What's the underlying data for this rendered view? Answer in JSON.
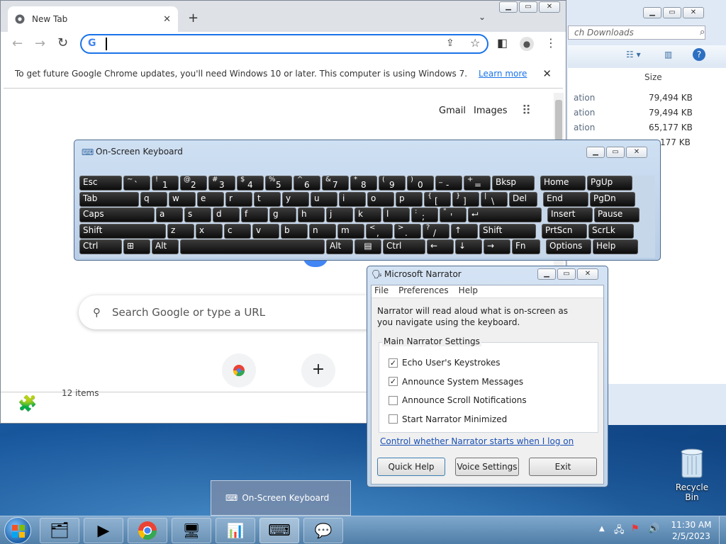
{
  "chrome": {
    "tab_title": "New Tab",
    "omnibox_value": "",
    "infobar_text": "To get future Google Chrome updates, you'll need Windows 10 or later. This computer is using Windows 7.",
    "infobar_link": "Learn more",
    "ntp_links": [
      "Gmail",
      "Images"
    ],
    "ntp_search_placeholder": "Search Google or type a URL",
    "status_fragment": "12 items"
  },
  "explorer": {
    "search_placeholder": "ch Downloads",
    "size_header": "Size",
    "rows": [
      {
        "type": "ation",
        "size": "79,494 KB"
      },
      {
        "type": "ation",
        "size": "79,494 KB"
      },
      {
        "type": "ation",
        "size": "65,177 KB"
      },
      {
        "type": "",
        "size": "177 KB"
      }
    ]
  },
  "osk": {
    "title": "On-Screen Keyboard",
    "rows": [
      [
        [
          "Esc",
          ""
        ],
        [
          "`",
          "~"
        ],
        [
          "1",
          "!"
        ],
        [
          "2",
          "@"
        ],
        [
          "3",
          "#"
        ],
        [
          "4",
          "$"
        ],
        [
          "5",
          "%"
        ],
        [
          "6",
          "^"
        ],
        [
          "7",
          "&"
        ],
        [
          "8",
          "*"
        ],
        [
          "9",
          "("
        ],
        [
          "0",
          ")"
        ],
        [
          "-",
          "_"
        ],
        [
          "=",
          "+"
        ],
        [
          "Bksp",
          ""
        ],
        [
          "Home",
          ""
        ],
        [
          "PgUp",
          ""
        ]
      ],
      [
        [
          "Tab",
          ""
        ],
        [
          "q",
          ""
        ],
        [
          "w",
          ""
        ],
        [
          "e",
          ""
        ],
        [
          "r",
          ""
        ],
        [
          "t",
          ""
        ],
        [
          "y",
          ""
        ],
        [
          "u",
          ""
        ],
        [
          "i",
          ""
        ],
        [
          "o",
          ""
        ],
        [
          "p",
          ""
        ],
        [
          "[",
          "{"
        ],
        [
          "]",
          "}"
        ],
        [
          "\\",
          "|"
        ],
        [
          "Del",
          ""
        ],
        [
          "End",
          ""
        ],
        [
          "PgDn",
          ""
        ]
      ],
      [
        [
          "Caps",
          ""
        ],
        [
          "a",
          ""
        ],
        [
          "s",
          ""
        ],
        [
          "d",
          ""
        ],
        [
          "f",
          ""
        ],
        [
          "g",
          ""
        ],
        [
          "h",
          ""
        ],
        [
          "j",
          ""
        ],
        [
          "k",
          ""
        ],
        [
          "l",
          ""
        ],
        [
          ";",
          ":"
        ],
        [
          "'",
          "\""
        ],
        [
          "⮠",
          ""
        ],
        [
          "Insert",
          ""
        ],
        [
          "Pause",
          ""
        ]
      ],
      [
        [
          "Shift",
          ""
        ],
        [
          "z",
          ""
        ],
        [
          "x",
          ""
        ],
        [
          "c",
          ""
        ],
        [
          "v",
          ""
        ],
        [
          "b",
          ""
        ],
        [
          "n",
          ""
        ],
        [
          "m",
          ""
        ],
        [
          ",",
          "<"
        ],
        [
          ".",
          ">"
        ],
        [
          "/",
          "?"
        ],
        [
          "↑",
          ""
        ],
        [
          "Shift",
          ""
        ],
        [
          "PrtScn",
          ""
        ],
        [
          "ScrLk",
          ""
        ]
      ],
      [
        [
          "Ctrl",
          ""
        ],
        [
          "⊞",
          ""
        ],
        [
          "Alt",
          ""
        ],
        [
          "",
          ""
        ],
        [
          "Alt",
          ""
        ],
        [
          "▤",
          ""
        ],
        [
          "Ctrl",
          ""
        ],
        [
          "←",
          ""
        ],
        [
          "↓",
          ""
        ],
        [
          "→",
          ""
        ],
        [
          "Fn",
          ""
        ],
        [
          "Options",
          ""
        ],
        [
          "Help",
          ""
        ]
      ]
    ]
  },
  "narrator": {
    "title": "Microsoft Narrator",
    "menu": [
      "File",
      "Preferences",
      "Help"
    ],
    "description": "Narrator will read aloud what is on-screen as you navigate using the keyboard.",
    "group_title": "Main Narrator Settings",
    "options": [
      {
        "label": "Echo User's Keystrokes",
        "checked": true
      },
      {
        "label": "Announce System Messages",
        "checked": true
      },
      {
        "label": "Announce Scroll Notifications",
        "checked": false
      },
      {
        "label": "Start Narrator Minimized",
        "checked": false
      }
    ],
    "link": "Control whether Narrator starts when I log on",
    "buttons": [
      "Quick Help",
      "Voice Settings",
      "Exit"
    ]
  },
  "taskbar": {
    "preview_label": "On-Screen Keyboard",
    "time": "11:30 AM",
    "date": "2/5/2023"
  },
  "desktop": {
    "recycle_bin": "Recycle Bin"
  }
}
